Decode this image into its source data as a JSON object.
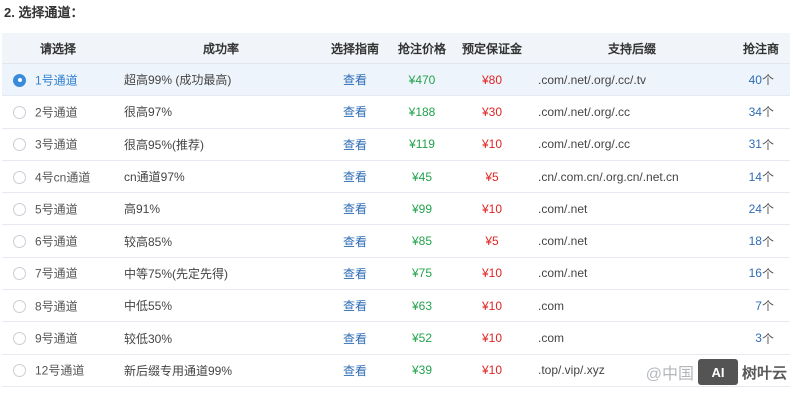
{
  "section_title": "2. 选择通道：",
  "columns": [
    "请选择",
    "成功率",
    "选择指南",
    "抢注价格",
    "预定保证金",
    "支持后缀",
    "抢注商"
  ],
  "rows": [
    {
      "channel": "1号通道",
      "rate": "超高99% (成功最高)",
      "guide": "查看",
      "price": "¥470",
      "deposit": "¥80",
      "suffix": ".com/.net/.org/.cc/.tv",
      "count": "40",
      "unit": "个",
      "selected": true
    },
    {
      "channel": "2号通道",
      "rate": "很高97%",
      "guide": "查看",
      "price": "¥188",
      "deposit": "¥30",
      "suffix": ".com/.net/.org/.cc",
      "count": "34",
      "unit": "个",
      "selected": false
    },
    {
      "channel": "3号通道",
      "rate": "很高95%(推荐)",
      "guide": "查看",
      "price": "¥119",
      "deposit": "¥10",
      "suffix": ".com/.net/.org/.cc",
      "count": "31",
      "unit": "个",
      "selected": false
    },
    {
      "channel": "4号cn通道",
      "rate": "cn通道97%",
      "guide": "查看",
      "price": "¥45",
      "deposit": "¥5",
      "suffix": ".cn/.com.cn/.org.cn/.net.cn",
      "count": "14",
      "unit": "个",
      "selected": false
    },
    {
      "channel": "5号通道",
      "rate": "高91%",
      "guide": "查看",
      "price": "¥99",
      "deposit": "¥10",
      "suffix": ".com/.net",
      "count": "24",
      "unit": "个",
      "selected": false
    },
    {
      "channel": "6号通道",
      "rate": "较高85%",
      "guide": "查看",
      "price": "¥85",
      "deposit": "¥5",
      "suffix": ".com/.net",
      "count": "18",
      "unit": "个",
      "selected": false
    },
    {
      "channel": "7号通道",
      "rate": "中等75%(先定先得)",
      "guide": "查看",
      "price": "¥75",
      "deposit": "¥10",
      "suffix": ".com/.net",
      "count": "16",
      "unit": "个",
      "selected": false
    },
    {
      "channel": "8号通道",
      "rate": "中低55%",
      "guide": "查看",
      "price": "¥63",
      "deposit": "¥10",
      "suffix": ".com",
      "count": "7",
      "unit": "个",
      "selected": false
    },
    {
      "channel": "9号通道",
      "rate": "较低30%",
      "guide": "查看",
      "price": "¥52",
      "deposit": "¥10",
      "suffix": ".com",
      "count": "3",
      "unit": "个",
      "selected": false
    },
    {
      "channel": "12号通道",
      "rate": "新后缀专用通道99%",
      "guide": "查看",
      "price": "¥39",
      "deposit": "¥10",
      "suffix": ".top/.vip/.xyz",
      "count": "",
      "unit": "",
      "selected": false
    }
  ],
  "watermark": {
    "left": "@中国",
    "logo": "AI",
    "right": "树叶云"
  }
}
